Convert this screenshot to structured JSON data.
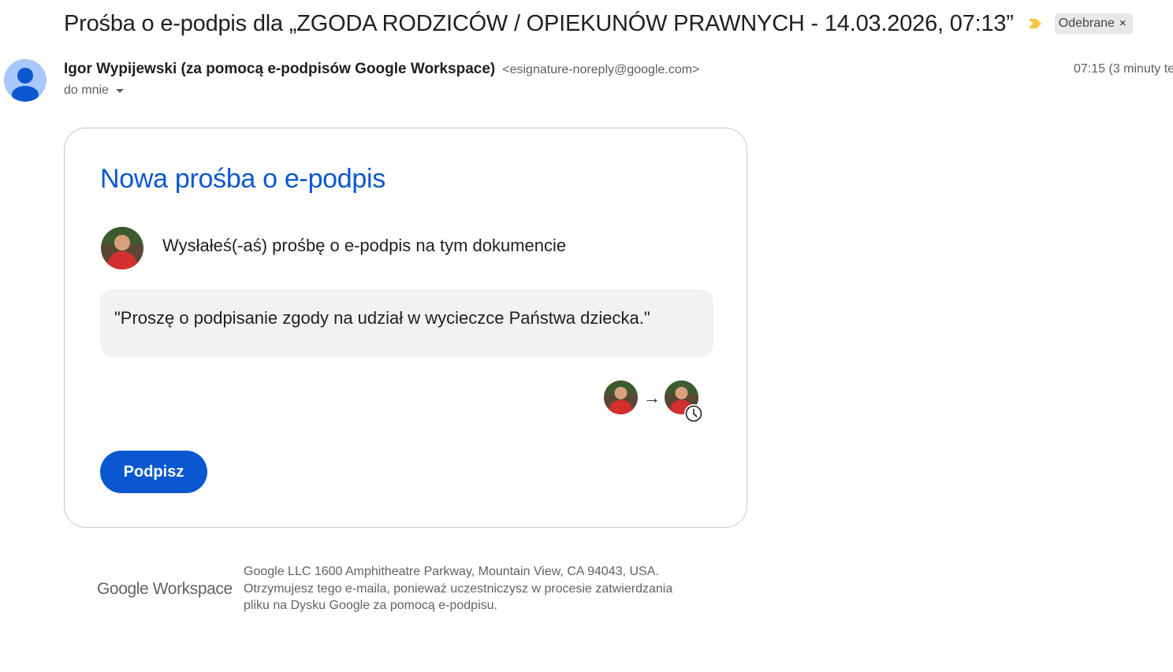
{
  "email": {
    "subject": "Prośba o e-podpis dla „ZGODA RODZICÓW / OPIEKUNÓW PRAWNYCH - 14.03.2026, 07:13”",
    "label": "Odebrane",
    "label_remove": "×",
    "sender_name": "Igor Wypijewski (za pomocą e-podpisów Google Workspace)",
    "sender_email": "<esignature-noreply@google.com>",
    "to": "do mnie",
    "time": "07:15 (3 minuty te"
  },
  "card": {
    "title": "Nowa prośba o e-podpis",
    "request_text": "Wysłałeś(-aś) prośbę o e-podpis na tym dokumencie",
    "message": "\"Proszę o podpisanie zgody na udział w wycieczce Państwa dziecka.\"",
    "arrow": "→",
    "sign_button": "Podpisz"
  },
  "footer": {
    "logo": "Google Workspace",
    "lines": [
      "Google LLC 1600 Amphitheatre Parkway, Mountain View, CA 94043, USA.",
      "Otrzymujesz tego e-maila, ponieważ uczestniczysz w procesie zatwierdzania",
      "pliku na Dysku Google za pomocą e-podpisu."
    ]
  },
  "colors": {
    "accent": "#0b57d0",
    "important_marker": "#f4c542",
    "avatar_default": "#a8c7fa",
    "avatar_person_shirt": "#d32f2f"
  },
  "icons": {
    "important": "important-marker-icon",
    "default_avatar": "person-icon",
    "pending": "clock-icon"
  }
}
